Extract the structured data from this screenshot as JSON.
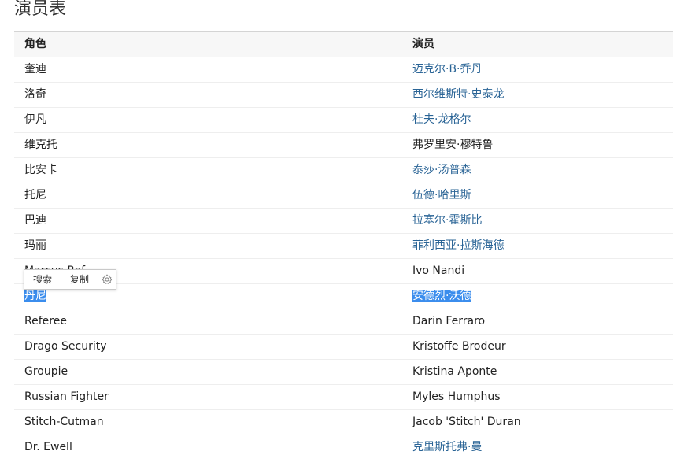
{
  "section": {
    "title": "演员表"
  },
  "table": {
    "headers": {
      "role": "角色",
      "actor": "演员"
    },
    "rows": [
      {
        "role": "奎迪",
        "actor": "迈克尔·B·乔丹",
        "actor_link": true
      },
      {
        "role": "洛奇",
        "actor": "西尔维斯特·史泰龙",
        "actor_link": true
      },
      {
        "role": "伊凡",
        "actor": "杜夫·龙格尔",
        "actor_link": true
      },
      {
        "role": "维克托",
        "actor": "弗罗里安·穆特鲁",
        "actor_link": false
      },
      {
        "role": "比安卡",
        "actor": "泰莎·汤普森",
        "actor_link": true
      },
      {
        "role": "托尼",
        "actor": "伍德·哈里斯",
        "actor_link": true
      },
      {
        "role": "巴迪",
        "actor": "拉塞尔·霍斯比",
        "actor_link": true
      },
      {
        "role": "玛丽",
        "actor": "菲利西亚·拉斯海德",
        "actor_link": true
      },
      {
        "role": "Marcus Ref",
        "actor": "Ivo Nandi",
        "actor_link": false
      },
      {
        "role": "丹尼",
        "actor": "安德烈·沃德",
        "actor_link": true
      },
      {
        "role": "Referee",
        "actor": "Darin Ferraro",
        "actor_link": false
      },
      {
        "role": "Drago Security",
        "actor": "Kristoffe Brodeur",
        "actor_link": false
      },
      {
        "role": "Groupie",
        "actor": "Kristina Aponte",
        "actor_link": false
      },
      {
        "role": "Russian Fighter",
        "actor": "Myles Humphus",
        "actor_link": false
      },
      {
        "role": "Stitch-Cutman",
        "actor": "Jacob 'Stitch' Duran",
        "actor_link": false
      },
      {
        "role": "Dr. Ewell",
        "actor": "克里斯托弗·曼",
        "actor_link": true
      }
    ]
  },
  "selection_toolbar": {
    "search_label": "搜索",
    "copy_label": "复制",
    "settings_icon": "gear-icon"
  },
  "colors": {
    "link": "#2a6496",
    "selection": "#3b8ded"
  }
}
